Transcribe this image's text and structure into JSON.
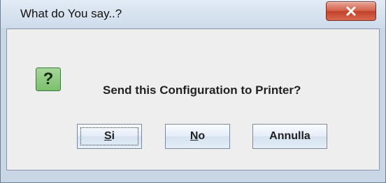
{
  "window": {
    "title": "What do You say..?"
  },
  "dialog": {
    "icon": "question-icon",
    "icon_glyph": "?",
    "message": "Send this Configuration to Printer?"
  },
  "buttons": {
    "yes": {
      "mnemonic": "S",
      "rest": "i"
    },
    "no": {
      "mnemonic": "N",
      "rest": "o"
    },
    "cancel": {
      "label": "Annulla"
    }
  },
  "colors": {
    "close_button": "#c9513c",
    "question_icon": "#8cc97e"
  }
}
